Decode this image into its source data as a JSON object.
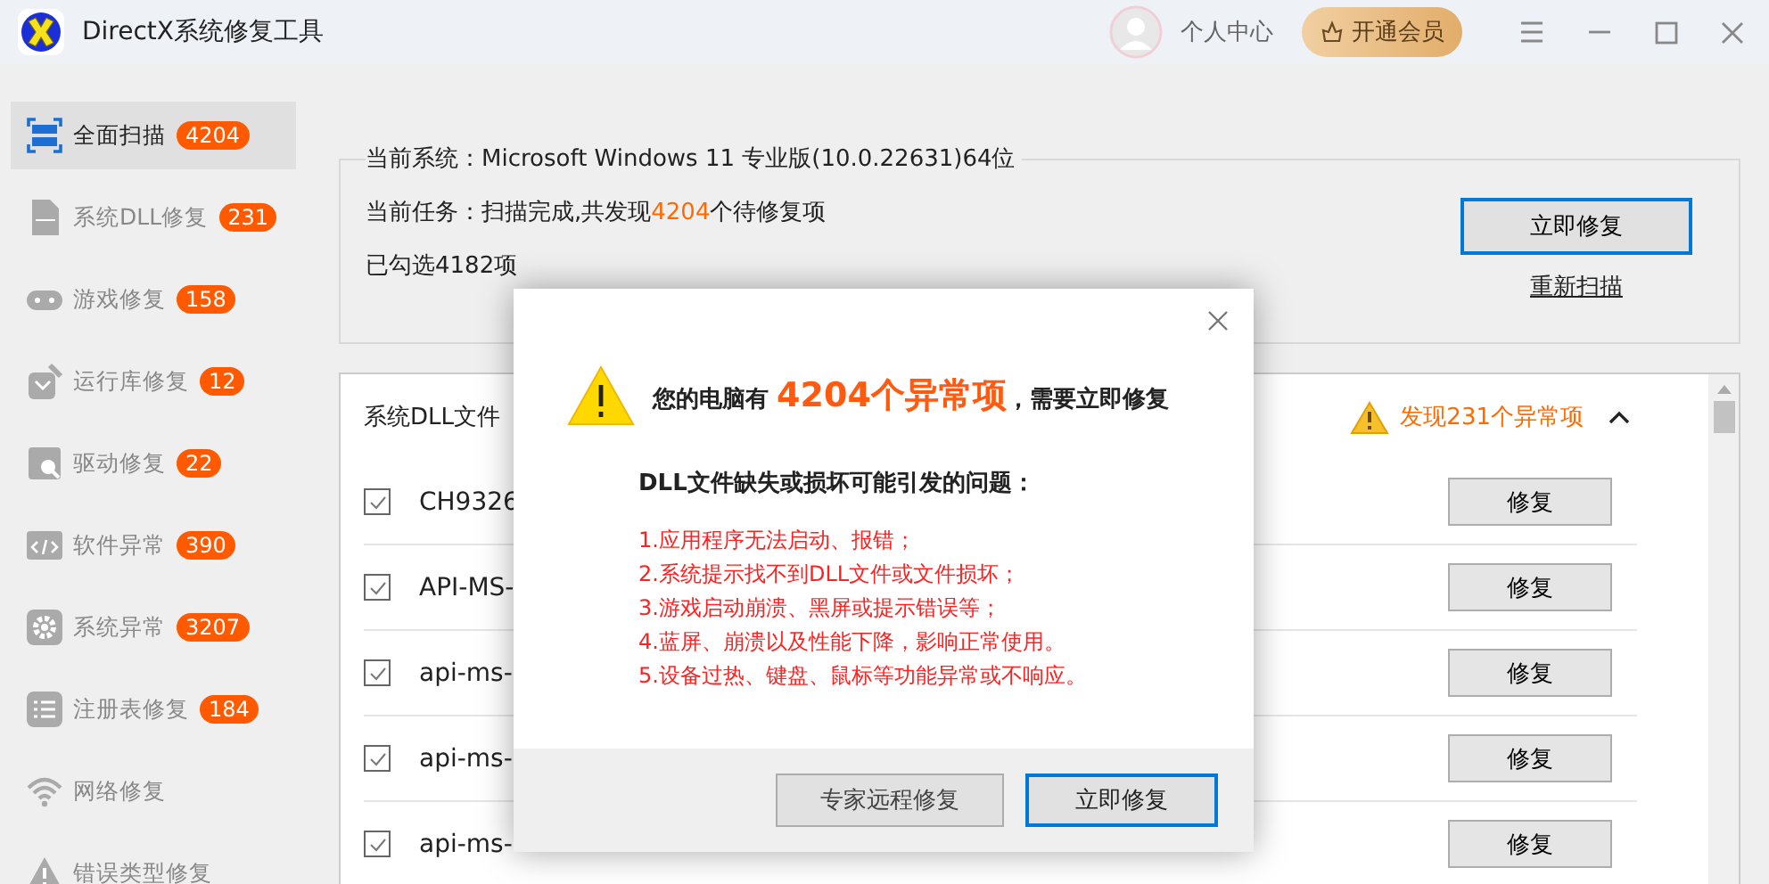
{
  "window": {
    "title": "DirectX系统修复工具",
    "user_center": "个人中心",
    "vip_button": "开通会员"
  },
  "sidebar": {
    "items": [
      {
        "label": "全面扫描",
        "count": "4204",
        "selected": true,
        "kind": "scan"
      },
      {
        "label": "系统DLL修复",
        "count": "231",
        "selected": false,
        "kind": "dll"
      },
      {
        "label": "游戏修复",
        "count": "158",
        "selected": false,
        "kind": "game"
      },
      {
        "label": "运行库修复",
        "count": "12",
        "selected": false,
        "kind": "runtime"
      },
      {
        "label": "驱动修复",
        "count": "22",
        "selected": false,
        "kind": "driver"
      },
      {
        "label": "软件异常",
        "count": "390",
        "selected": false,
        "kind": "code"
      },
      {
        "label": "系统异常",
        "count": "3207",
        "selected": false,
        "kind": "gear"
      },
      {
        "label": "注册表修复",
        "count": "184",
        "selected": false,
        "kind": "list"
      },
      {
        "label": "网络修复",
        "selected": false,
        "kind": "wifi"
      },
      {
        "label": "错误类型修复",
        "selected": false,
        "kind": "warning"
      }
    ]
  },
  "info": {
    "system": "当前系统：Microsoft Windows 11 专业版(10.0.22631)64位",
    "task_prefix": "当前任务：扫描完成,共发现",
    "task_count": "4204",
    "task_suffix": "个待修复项",
    "selected_count": "已勾选4182项",
    "repair_button": "立即修复",
    "rescan_link": "重新扫描"
  },
  "list": {
    "title": "系统DLL文件",
    "anomaly": "发现231个异常项",
    "expanded": true,
    "rows": [
      {
        "name": "CH9326",
        "checked": true,
        "button": "修复"
      },
      {
        "name": "API-MS-",
        "checked": true,
        "button": "修复"
      },
      {
        "name": "api-ms-",
        "checked": true,
        "button": "修复"
      },
      {
        "name": "api-ms-",
        "checked": true,
        "button": "修复"
      },
      {
        "name": "api-ms-",
        "checked": true,
        "button": "修复"
      }
    ]
  },
  "dialog": {
    "headline_prefix": "您的电脑有",
    "headline_count": "4204个异常项",
    "headline_suffix": "，需要立即修复",
    "subtitle": "DLL文件缺失或损坏可能引发的问题：",
    "problems": [
      "1.应用程序无法启动、报错；",
      "2.系统提示找不到DLL文件或文件损坏；",
      "3.游戏启动崩溃、黑屏或提示错误等；",
      "4.蓝屏、崩溃以及性能下降，影响正常使用。",
      "5.设备过热、键盘、鼠标等功能异常或不响应。"
    ],
    "buttons": [
      {
        "label": "专家远程修复",
        "kind": "secondary"
      },
      {
        "label": "立即修复",
        "kind": "primary"
      }
    ]
  }
}
